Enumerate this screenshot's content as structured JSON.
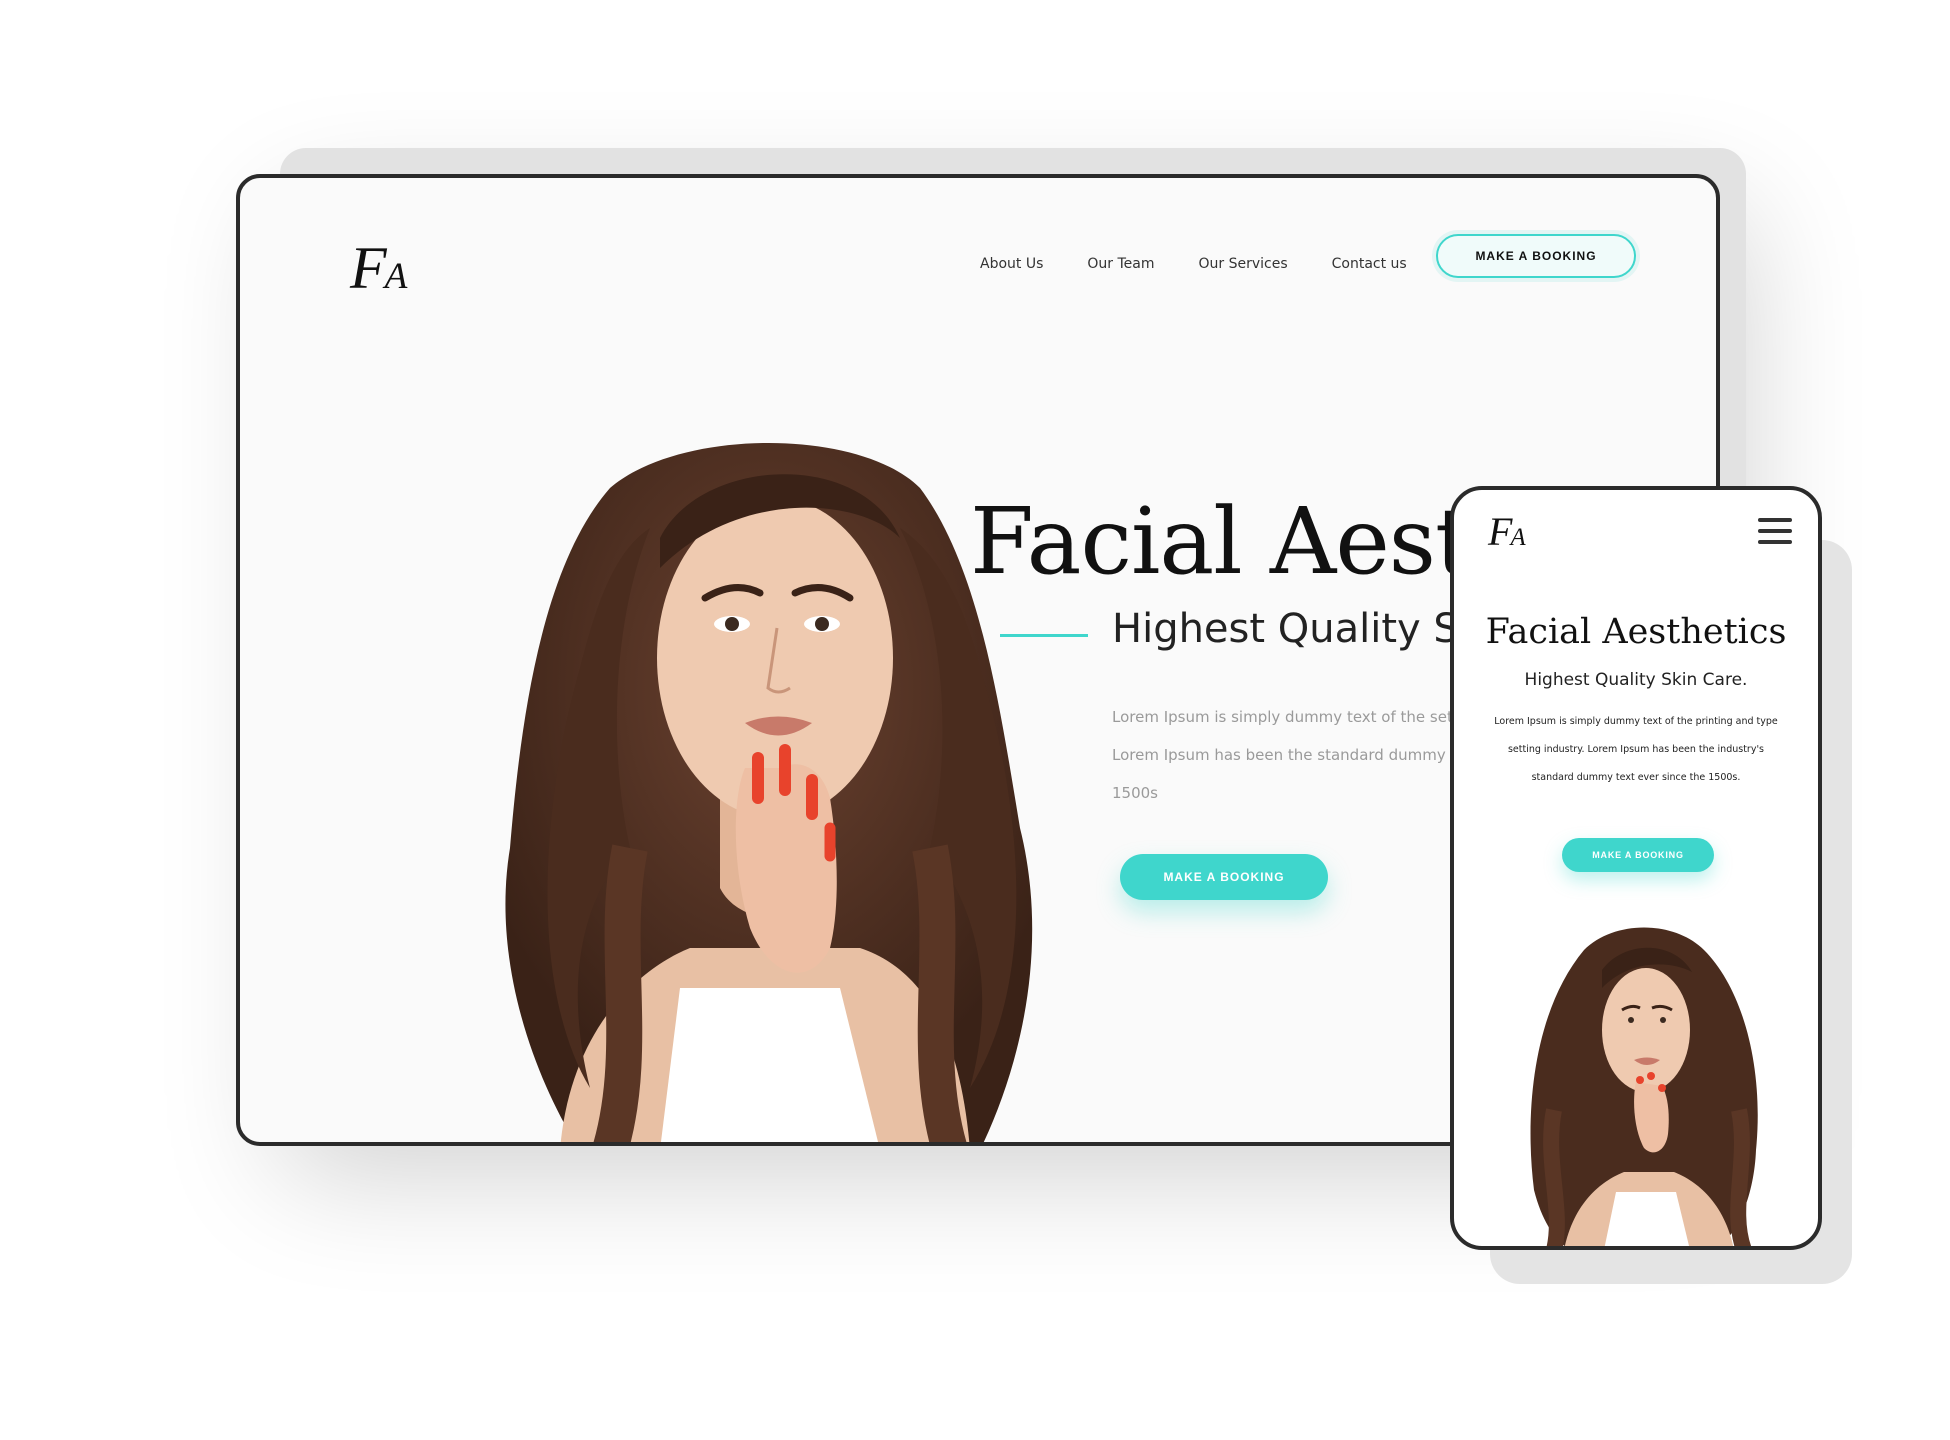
{
  "desktop": {
    "logo_main": "F",
    "logo_sub": "A",
    "nav": [
      "About Us",
      "Our Team",
      "Our Services",
      "Contact us"
    ],
    "nav_button": "MAKE A BOOKING",
    "hero_title": "Facial Aesth",
    "hero_subtitle": "Highest Quality Sk",
    "hero_body": "Lorem Ipsum is simply dummy text of the setting industry. Lorem Ipsum has been the standard dummy text ever since the 1500s",
    "cta_button": "MAKE A BOOKING"
  },
  "mobile": {
    "logo_main": "F",
    "logo_sub": "A",
    "hero_title": "Facial Aesthetics",
    "hero_subtitle": "Highest Quality Skin Care.",
    "hero_body": "Lorem Ipsum is simply dummy text of the printing and type setting industry. Lorem Ipsum has been the industry's standard dummy text ever since the 1500s.",
    "cta_button": "MAKE A BOOKING"
  },
  "colors": {
    "accent": "#3fd6cc",
    "text_dark": "#111111",
    "hair": "#4a2c1e",
    "skin": "#e9c2a6",
    "nails": "#e8432c"
  }
}
